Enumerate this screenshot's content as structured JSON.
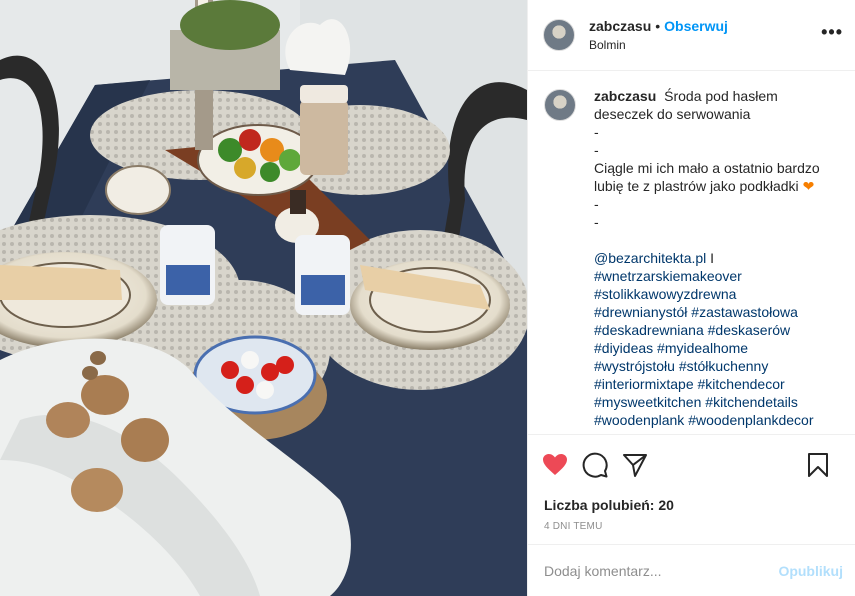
{
  "header": {
    "username": "zabczasu",
    "separator": "•",
    "follow_label": "Obserwuj",
    "location": "Bolmin",
    "more_label": "•••"
  },
  "caption": {
    "username": "zabczasu",
    "lines": [
      "Środa pod hasłem deseczek do serwowania",
      "-",
      "-",
      "Ciągle mi ich mało a ostatnio bardzo lubię te z plastrów jako podkładki",
      "-",
      "-"
    ],
    "emoji": "❤",
    "mention_line": [
      "@bezarchitekta.pl",
      " I"
    ],
    "hashtags": [
      "#wnetrzarskiemakeover",
      "#stolikkawowyzdrewna",
      "#drewnianystół",
      "#zastawastołowa",
      "#deskadrewniana",
      "#deskaserów",
      "#diyideas",
      "#myidealhome",
      "#wystrójstołu",
      "#stółkuchenny",
      "#interiormixtape",
      "#kitchendecor",
      "#mysweetkitchen",
      "#kitchendetails",
      "#woodenplank",
      "#woodenplankdecor"
    ]
  },
  "actions": {
    "like_icon": "heart-filled-icon",
    "comment_icon": "comment-icon",
    "share_icon": "share-icon",
    "save_icon": "bookmark-icon",
    "like_color": "#ed4956"
  },
  "likes": {
    "label": "Liczba polubień: 20"
  },
  "timestamp": "4 DNI TEMU",
  "comment": {
    "placeholder": "Dodaj komentarz...",
    "post_label": "Opublikuj"
  },
  "colors": {
    "link": "#0095f6",
    "hashtag": "#00376b",
    "muted": "#8e8e8e",
    "post_disabled": "#b2dffc"
  }
}
